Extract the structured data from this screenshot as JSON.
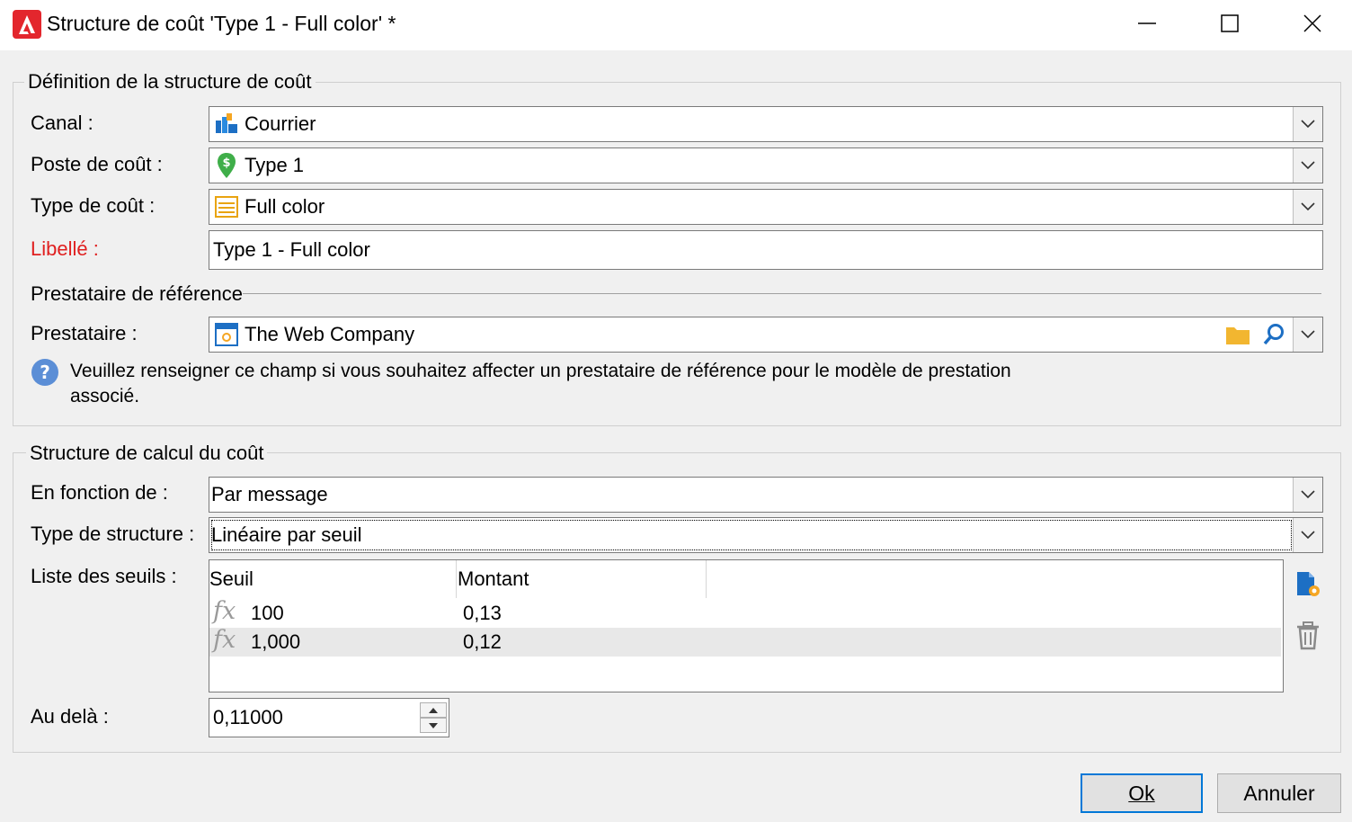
{
  "window": {
    "title": "Structure de coût 'Type 1 - Full color' *",
    "minimize_icon": "minimize-icon",
    "maximize_icon": "maximize-icon",
    "close_icon": "close-icon"
  },
  "definition_group": {
    "title": "Définition de la structure de coût",
    "channel": {
      "label": "Canal :",
      "value": "Courrier",
      "icon": "mail-channel-icon"
    },
    "cost_item": {
      "label": "Poste de coût :",
      "value": "Type 1",
      "icon": "cost-pin-icon"
    },
    "cost_type": {
      "label": "Type de coût :",
      "value": "Full color",
      "icon": "cost-type-icon"
    },
    "wording": {
      "label": "Libellé :",
      "value": "Type 1 - Full color"
    },
    "reference_provider": {
      "section_title": "Prestataire de référence",
      "label": "Prestataire :",
      "value": "The Web Company",
      "help_line1": "Veuillez renseigner ce champ si vous souhaitez affecter un prestataire de référence pour le modèle de prestation",
      "help_line2": "associé."
    }
  },
  "calc_group": {
    "title": "Structure de calcul du coût",
    "based_on": {
      "label": "En fonction de :",
      "value": "Par message"
    },
    "structure_type": {
      "label": "Type de structure :",
      "value": "Linéaire par seuil"
    },
    "thresholds": {
      "label": "Liste des seuils :",
      "columns": [
        "Seuil",
        "Montant"
      ],
      "rows": [
        {
          "seuil": "100",
          "montant": "0,13"
        },
        {
          "seuil": "1,000",
          "montant": "0,12"
        }
      ]
    },
    "beyond": {
      "label": "Au delà :",
      "value": "0,11000"
    }
  },
  "buttons": {
    "ok": "Ok",
    "cancel": "Annuler"
  },
  "colors": {
    "accent": "#0078d7",
    "required": "#e02020",
    "logo": "#e3262d"
  }
}
